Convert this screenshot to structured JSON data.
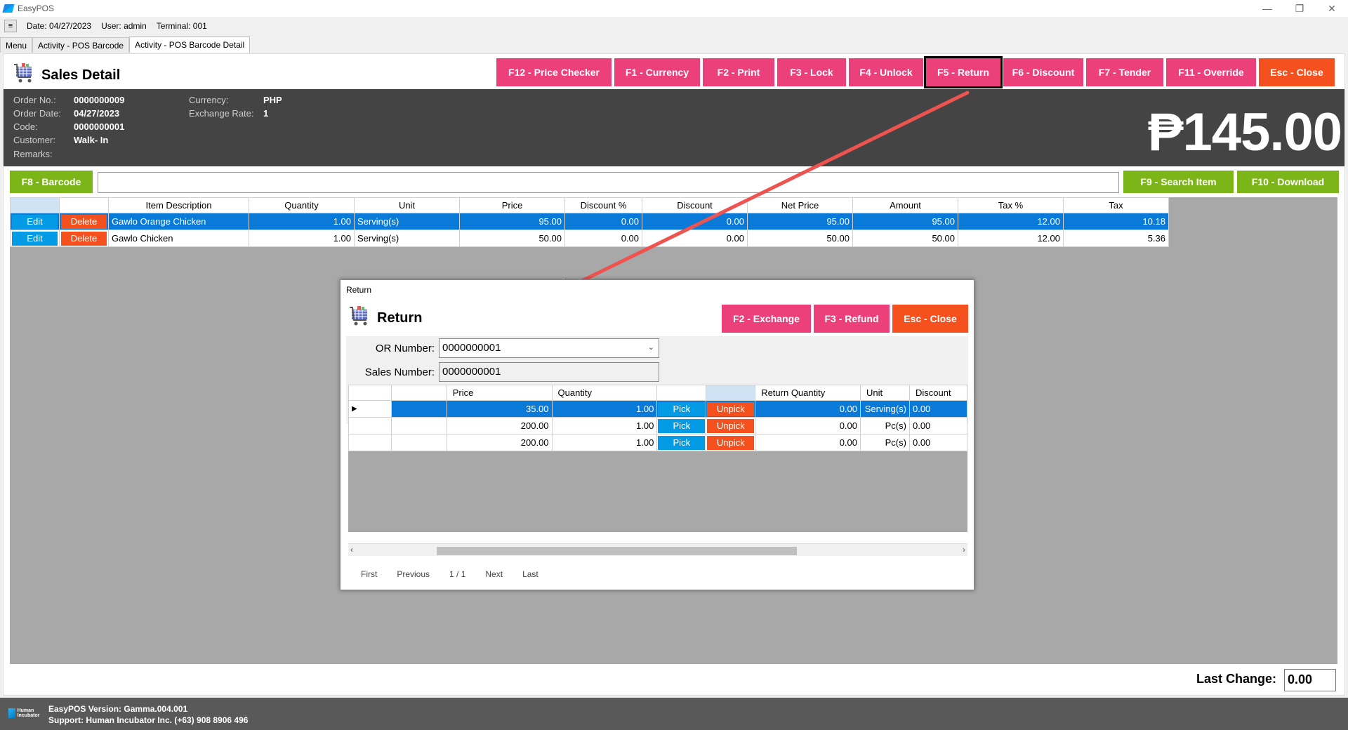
{
  "app": {
    "title": "EasyPOS"
  },
  "info": {
    "date": "Date: 04/27/2023",
    "user": "User: admin",
    "terminal": "Terminal: 001",
    "menu_toggle": "≡"
  },
  "tabs": [
    {
      "label": "Menu"
    },
    {
      "label": "Activity - POS Barcode"
    },
    {
      "label": "Activity - POS Barcode Detail"
    }
  ],
  "page": {
    "title": "Sales Detail"
  },
  "toolbar": [
    {
      "label": "F12 - Price Checker"
    },
    {
      "label": "F1 - Currency"
    },
    {
      "label": "F2 - Print"
    },
    {
      "label": "F3 - Lock"
    },
    {
      "label": "F4 - Unlock"
    },
    {
      "label": "F5 - Return"
    },
    {
      "label": "F6 - Discount"
    },
    {
      "label": "F7 - Tender"
    },
    {
      "label": "F11 - Override"
    },
    {
      "label": "Esc - Close"
    }
  ],
  "order": {
    "order_no_label": "Order No.:",
    "order_no": "0000000009",
    "order_date_label": "Order Date:",
    "order_date": "04/27/2023",
    "code_label": "Code:",
    "code": "0000000001",
    "customer_label": "Customer:",
    "customer": "Walk- In",
    "remarks_label": "Remarks:",
    "currency_label": "Currency:",
    "currency": "PHP",
    "exchange_label": "Exchange Rate:",
    "exchange": "1",
    "total": "₱145.00"
  },
  "barcode": {
    "button": "F8 - Barcode",
    "value": "",
    "search": "F9 - Search Item",
    "download": "F10 - Download"
  },
  "grid": {
    "headers": [
      "",
      "",
      "Item Description",
      "Quantity",
      "Unit",
      "Price",
      "Discount %",
      "Discount",
      "Net Price",
      "Amount",
      "Tax %",
      "Tax"
    ],
    "edit_label": "Edit",
    "delete_label": "Delete",
    "rows": [
      {
        "desc": "Gawlo Orange Chicken",
        "qty": "1.00",
        "unit": "Serving(s)",
        "price": "95.00",
        "disc_pct": "0.00",
        "disc": "0.00",
        "net": "95.00",
        "amount": "95.00",
        "tax_pct": "12.00",
        "tax": "10.18"
      },
      {
        "desc": "Gawlo Chicken",
        "qty": "1.00",
        "unit": "Serving(s)",
        "price": "50.00",
        "disc_pct": "0.00",
        "disc": "0.00",
        "net": "50.00",
        "amount": "50.00",
        "tax_pct": "12.00",
        "tax": "5.36"
      }
    ]
  },
  "last_change": {
    "label": "Last Change:",
    "value": "0.00"
  },
  "footer": {
    "version": "EasyPOS Version: Gamma.004.001",
    "support": "Support: Human Incubator Inc. (+63) 908 8906 496",
    "logo_text": "Human Incubator"
  },
  "dialog": {
    "window_title": "Return",
    "title": "Return",
    "buttons": [
      {
        "label": "F2 - Exchange"
      },
      {
        "label": "F3 - Refund"
      },
      {
        "label": "Esc - Close"
      }
    ],
    "or_label": "OR Number:",
    "or_value": "0000000001",
    "sales_label": "Sales Number:",
    "sales_value": "0000000001",
    "headers": [
      "",
      "",
      "Price",
      "Quantity",
      "",
      "",
      "Return Quantity",
      "Unit",
      "Discount"
    ],
    "pick_label": "Pick",
    "unpick_label": "Unpick",
    "rows": [
      {
        "price": "35.00",
        "qty": "1.00",
        "ret_qty": "0.00",
        "unit": "Serving(s)",
        "disc": "0.00"
      },
      {
        "price": "200.00",
        "qty": "1.00",
        "ret_qty": "0.00",
        "unit": "Pc(s)",
        "disc": "0.00"
      },
      {
        "price": "200.00",
        "qty": "1.00",
        "ret_qty": "0.00",
        "unit": "Pc(s)",
        "disc": "0.00"
      }
    ],
    "pager": {
      "first": "First",
      "previous": "Previous",
      "page": "1 / 1",
      "next": "Next",
      "last": "Last"
    }
  },
  "colors": {
    "pink": "#ec407a",
    "orange": "#f4511e",
    "green": "#7cb518",
    "blue": "#039be5",
    "selected_row": "#0a7ad8"
  }
}
